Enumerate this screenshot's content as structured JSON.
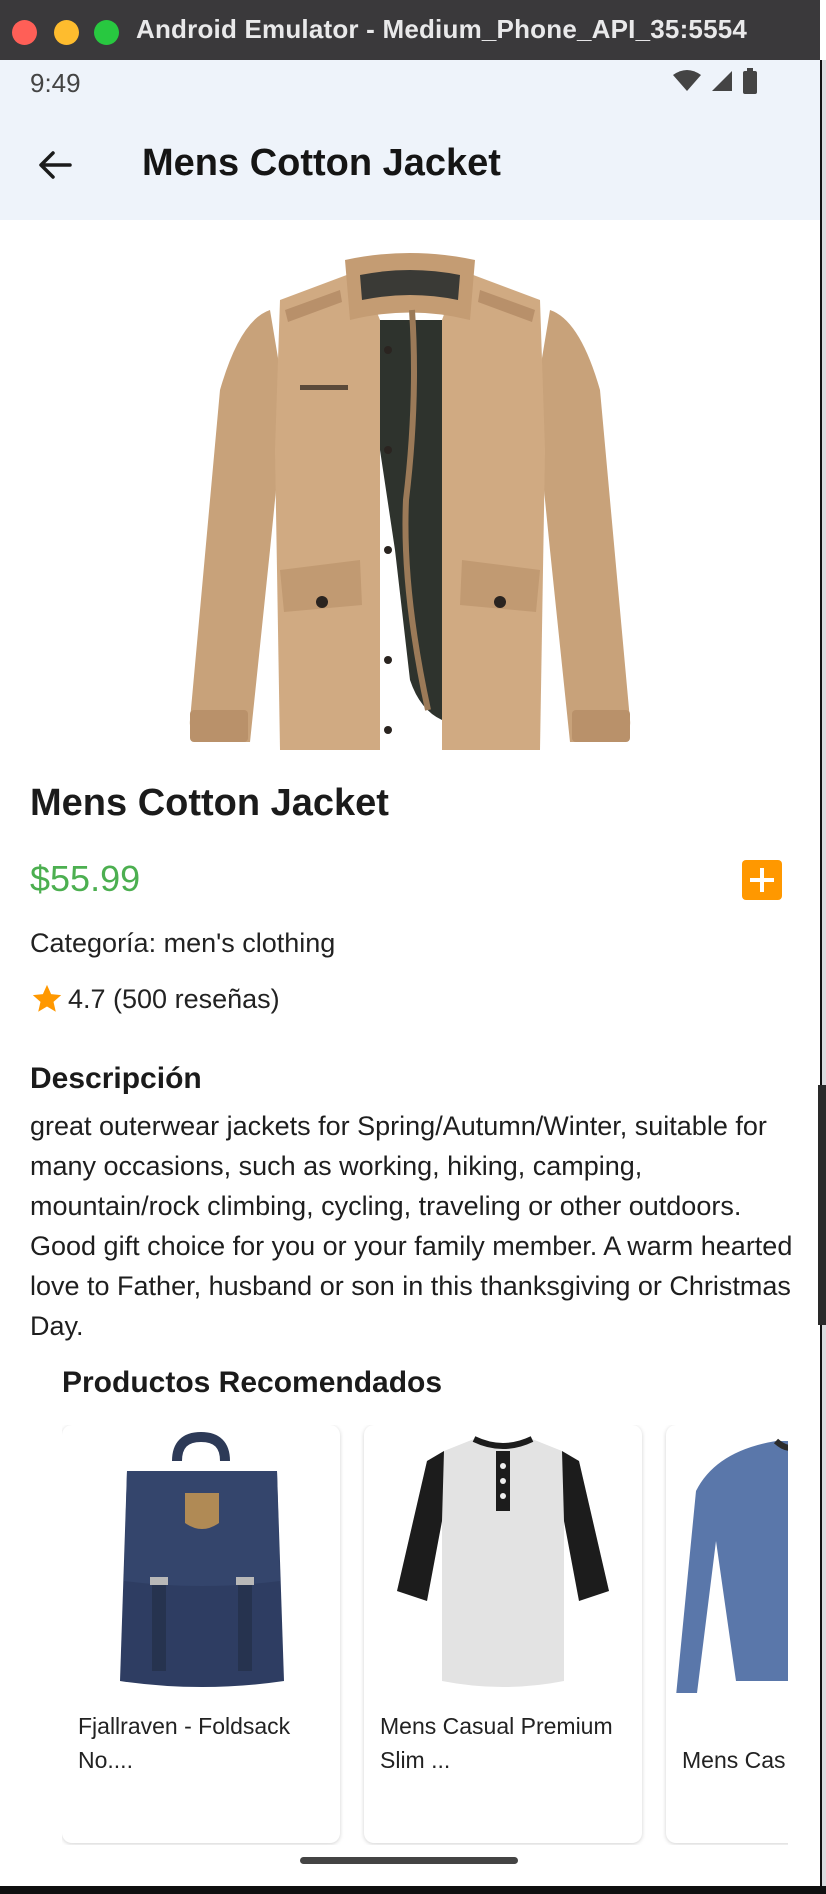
{
  "window": {
    "title": "Android Emulator - Medium_Phone_API_35:5554"
  },
  "status_bar": {
    "time": "9:49"
  },
  "app_bar": {
    "title": "Mens Cotton Jacket",
    "back_icon": "arrow-back-icon"
  },
  "product": {
    "name": "Mens Cotton Jacket",
    "price": "$55.99",
    "category": "Categoría: men's clothing",
    "rating": "4.7 (500 reseñas)",
    "description_title": "Descripción",
    "description": "great outerwear jackets for Spring/Autumn/Winter, suitable for many occasions, such as working, hiking, camping, mountain/rock climbing, cycling, traveling or other outdoors. Good gift choice for you or your family member. A warm hearted love to Father, husband or son in this thanksgiving or Christmas Day."
  },
  "recommended": {
    "title": "Productos Recomendados",
    "items": [
      {
        "label": "Fjallraven - Foldsack No...."
      },
      {
        "label": "Mens Casual Premium Slim ..."
      },
      {
        "label": "Mens Cas"
      }
    ]
  },
  "colors": {
    "price": "#4caf50",
    "accent": "#ff9800",
    "star": "#ff9800",
    "app_bar": "#eef3fa"
  }
}
